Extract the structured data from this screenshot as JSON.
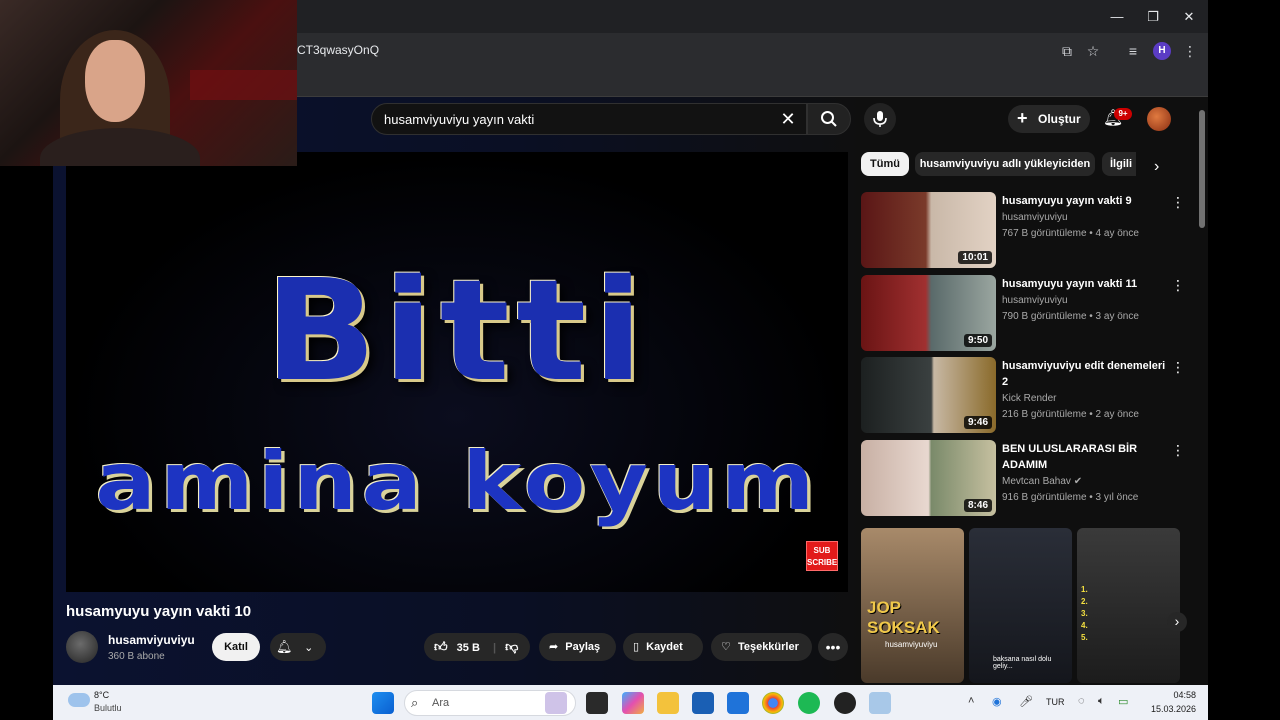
{
  "browser": {
    "url_fragment": "CT3qwasyOnQ",
    "window_controls": {
      "minimize": "—",
      "maximize": "❐",
      "close": "✕"
    },
    "profile_initial": "H"
  },
  "youtube": {
    "search": {
      "query": "husamviyuviyu yayın vakti"
    },
    "header": {
      "create_label": "Oluştur",
      "notifications_badge": "9+"
    },
    "player": {
      "line1": "Bitti",
      "line2": "amina koyum",
      "subscribe_overlay_top": "SUB",
      "subscribe_overlay_bottom": "SCRIBE"
    },
    "video": {
      "title": "husamyuyu yayın vakti 10",
      "channel_name": "husamviyuviyu",
      "channel_subs": "360 B abone",
      "join_label": "Katıl",
      "likes": "35 B",
      "share_label": "Paylaş",
      "save_label": "Kaydet",
      "thanks_label": "Teşekkürler"
    },
    "chips": [
      "Tümü",
      "husamviyuviyu adlı yükleyiciden",
      "İlgili"
    ],
    "recommendations": [
      {
        "title": "husamyuyu yayın vakti 9",
        "channel": "husamviyuviyu",
        "meta": "767 B görüntüleme • 4 ay önce",
        "duration": "10:01"
      },
      {
        "title": "husamyuyu yayın vakti 11",
        "channel": "husamviyuviyu",
        "meta": "790 B görüntüleme • 3 ay önce",
        "duration": "9:50"
      },
      {
        "title": "husamviyuviyu edit denemeleri 2",
        "channel": "Kick Render",
        "meta": "216 B görüntüleme • 2 ay önce",
        "duration": "9:46"
      },
      {
        "title": "BEN ULUSLARARASI BİR ADAMIM",
        "channel": "Mevtcan Bahav",
        "meta": "916 B görüntüleme • 3 yıl önce",
        "duration": "8:46"
      }
    ],
    "shorts": [
      {
        "caption_top": "JOP SOKSAK",
        "caption_bottom": "husamviyuviyu"
      },
      {
        "caption_top": "",
        "caption_bottom": "baksana nasıl dolu geliy..."
      },
      {
        "caption_top": "",
        "caption_bottom": ""
      }
    ]
  },
  "taskbar": {
    "weather_temp": "8°C",
    "weather_desc": "Bulutlu",
    "search_placeholder": "Ara",
    "language": "TUR",
    "time": "04:58",
    "date": "15.03.2026"
  },
  "colors": {
    "youtube_red": "#cc0000",
    "chip_active_bg": "#f1f1f1",
    "player_text": "#1b2fb0"
  }
}
